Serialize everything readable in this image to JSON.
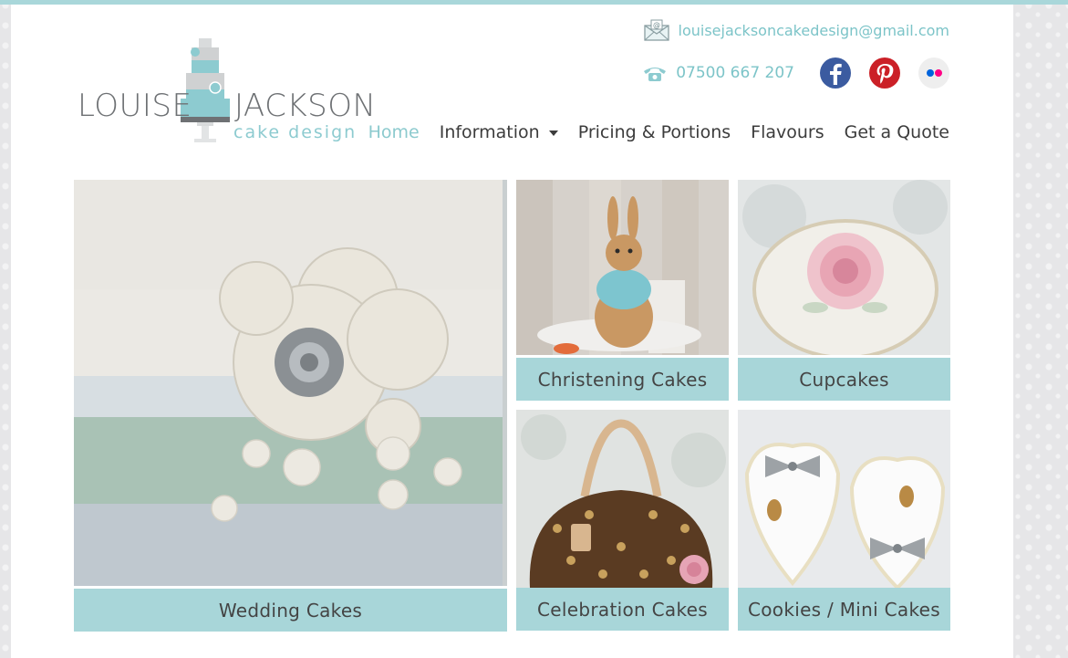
{
  "site": {
    "logo": {
      "line1a": "LOUISE",
      "line1b": "JACKSON",
      "line2": "cake design"
    },
    "email": "louisejacksoncakedesign@gmail.com",
    "phone": "07500 667 207"
  },
  "nav": {
    "home": "Home",
    "information": "Information",
    "pricing": "Pricing & Portions",
    "flavours": "Flavours",
    "quote": "Get a Quote"
  },
  "tiles": {
    "wedding": "Wedding Cakes",
    "christening": "Christening Cakes",
    "cupcakes": "Cupcakes",
    "celebration": "Celebration Cakes",
    "cookies": "Cookies / Mini Cakes"
  },
  "colors": {
    "accent": "#a8d6d9",
    "link": "#7cc4c8",
    "facebook": "#3b5ba0",
    "pinterest": "#cb2027"
  }
}
